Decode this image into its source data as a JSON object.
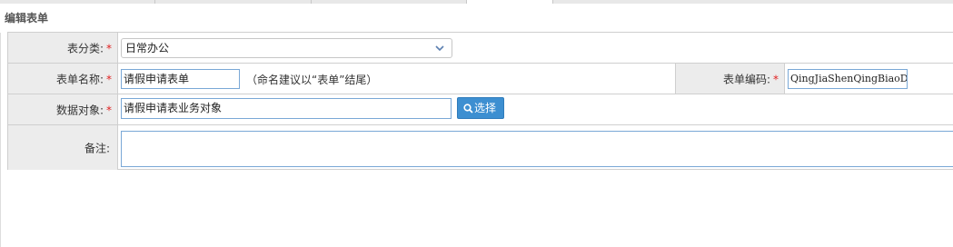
{
  "section_title": "编辑表单",
  "form": {
    "category": {
      "label": "表分类:",
      "required_mark": "*",
      "value": "日常办公"
    },
    "form_name": {
      "label": "表单名称:",
      "required_mark": "*",
      "value": "请假申请表单",
      "hint": "（命名建议以“表单”结尾）"
    },
    "form_code": {
      "label": "表单编码:",
      "required_mark": "*",
      "value": "QingJiaShenQingBiaoDan"
    },
    "data_object": {
      "label": "数据对象:",
      "required_mark": "*",
      "value": "请假申请表业务对象",
      "button_label": "选择"
    },
    "remarks": {
      "label": "备注:",
      "value": ""
    }
  },
  "colors": {
    "label_bg": "#ececec",
    "button_bg": "#3d8fd1",
    "required": "#e02020",
    "input_border": "#7aa8d6"
  },
  "icons": {
    "select_arrow": "chevron-down-icon",
    "select_button": "search-icon"
  }
}
